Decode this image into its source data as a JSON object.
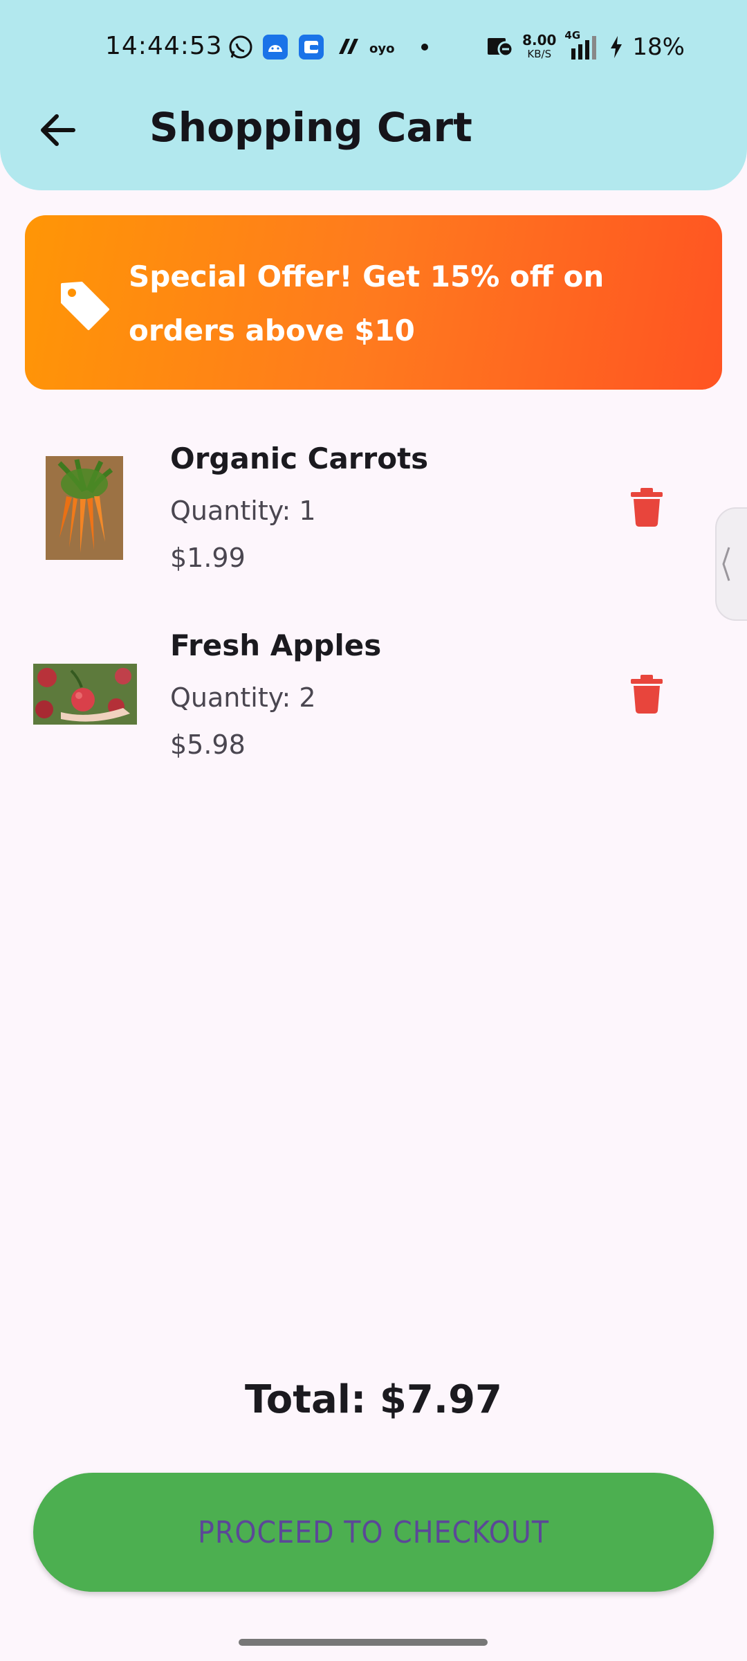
{
  "status_bar": {
    "time": "14:44:53",
    "network_speed": "8.00",
    "network_unit": "KB/S",
    "network_type": "4G",
    "battery": "18%",
    "notification_icons": [
      "whatsapp-icon",
      "android-icon",
      "wallet-icon",
      "app-icon",
      "oyo-icon",
      "dot-icon"
    ]
  },
  "header": {
    "title": "Shopping Cart",
    "back_icon": "arrow-back-icon"
  },
  "offer": {
    "icon": "tag-icon",
    "text": "Special Offer! Get 15% off on orders above $10"
  },
  "cart": {
    "items": [
      {
        "name": "Organic Carrots",
        "quantity": "Quantity: 1",
        "price": "$1.99",
        "image": "carrots-image"
      },
      {
        "name": "Fresh Apples",
        "quantity": "Quantity: 2",
        "price": "$5.98",
        "image": "apples-image"
      }
    ]
  },
  "summary": {
    "total": "Total: $7.97"
  },
  "checkout": {
    "label": "PROCEED TO CHECKOUT"
  },
  "colors": {
    "header_bg": "#b2e8ee",
    "offer_start": "#ff9606",
    "offer_end": "#ff5422",
    "delete": "#e8453c",
    "checkout_bg": "#4caf50",
    "checkout_text": "#5b4897"
  }
}
